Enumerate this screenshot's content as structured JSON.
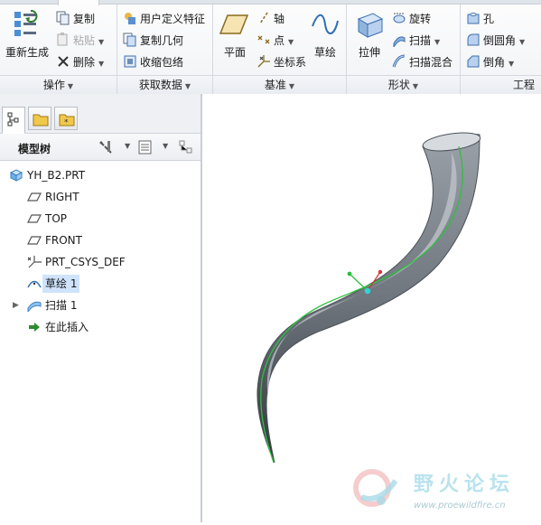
{
  "ribbon": {
    "groups": {
      "operations": {
        "label": "操作",
        "regenerate": "重新生成",
        "copy": "复制",
        "paste": "粘贴",
        "delete": "删除"
      },
      "get_data": {
        "label": "获取数据",
        "user_defined_feature": "用户定义特征",
        "copy_geometry": "复制几何",
        "shrinkwrap": "收缩包络"
      },
      "datum": {
        "label": "基准",
        "plane": "平面",
        "axis": "轴",
        "point": "点",
        "csys": "坐标系",
        "sketch": "草绘"
      },
      "shapes": {
        "label": "形状",
        "extrude": "拉伸",
        "revolve": "旋转",
        "sweep": "扫描",
        "swept_blend": "扫描混合"
      },
      "engineering": {
        "label": "工程",
        "hole": "孔",
        "round": "倒圆角",
        "chamfer": "倒角"
      }
    }
  },
  "panel": {
    "tree_title": "模型树",
    "items": [
      {
        "label": "YH_B2.PRT",
        "icon": "part-icon"
      },
      {
        "label": "RIGHT",
        "icon": "datum-plane-icon"
      },
      {
        "label": "TOP",
        "icon": "datum-plane-icon"
      },
      {
        "label": "FRONT",
        "icon": "datum-plane-icon"
      },
      {
        "label": "PRT_CSYS_DEF",
        "icon": "csys-icon"
      },
      {
        "label": "草绘 1",
        "icon": "sketch-icon"
      },
      {
        "label": "扫描 1",
        "icon": "sweep-icon"
      },
      {
        "label": "在此插入",
        "icon": "insert-here-icon"
      }
    ]
  },
  "watermark": {
    "title": "野火论坛",
    "url": "www.proewildfire.cn"
  },
  "colors": {
    "selection": "#cfe3fb",
    "model_body": "#6f767e",
    "trajectory": "#2fbf3f",
    "ribbon_bg": "#f1f3f6"
  }
}
